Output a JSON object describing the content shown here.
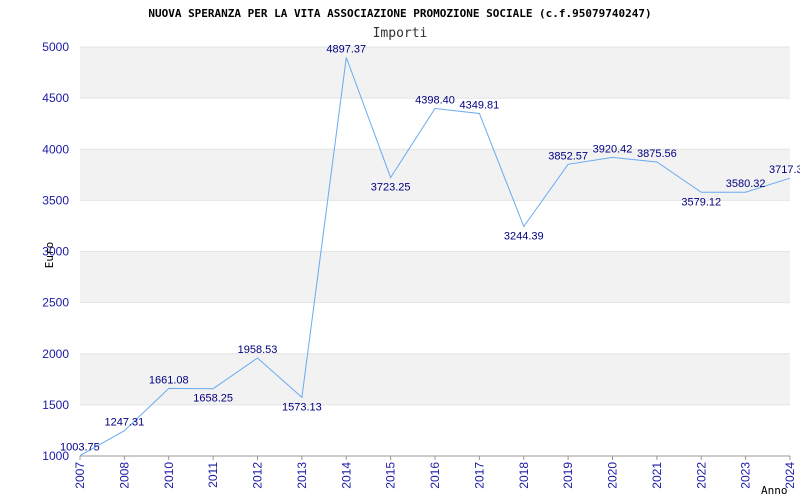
{
  "chart_data": {
    "type": "line",
    "title": "NUOVA SPERANZA PER LA VITA ASSOCIAZIONE PROMOZIONE SOCIALE (c.f.95079740247)",
    "subtitle": "Importi",
    "xlabel": "Anno",
    "ylabel": "Euro",
    "ylim": [
      1000,
      5000
    ],
    "yticks": [
      "1000",
      "1500",
      "2000",
      "2500",
      "3000",
      "3500",
      "4000",
      "4500",
      "5000"
    ],
    "grid": true,
    "x": [
      "2007",
      "2008",
      "2010",
      "2011",
      "2012",
      "2013",
      "2014",
      "2015",
      "2016",
      "2017",
      "2018",
      "2019",
      "2020",
      "2021",
      "2022",
      "2023",
      "2024"
    ],
    "values": [
      1003.75,
      1247.31,
      1661.08,
      1658.25,
      1958.53,
      1573.13,
      4897.37,
      3723.25,
      4398.4,
      4349.81,
      3244.39,
      3852.57,
      3920.42,
      3875.56,
      3579.12,
      3580.32,
      3717.3
    ],
    "labels": [
      "1003.75",
      "1247.31",
      "1661.08",
      "1658.25",
      "1958.53",
      "1573.13",
      "4897.37",
      "3723.25",
      "4398.40",
      "4349.81",
      "3244.39",
      "3852.57",
      "3920.42",
      "3875.56",
      "3579.12",
      "3580.32",
      "3717.3"
    ],
    "line_color": "#6aaaf0",
    "band_color": "#f2f2f2",
    "tick_color": "#1a1aa6",
    "label_color": "#000080"
  }
}
